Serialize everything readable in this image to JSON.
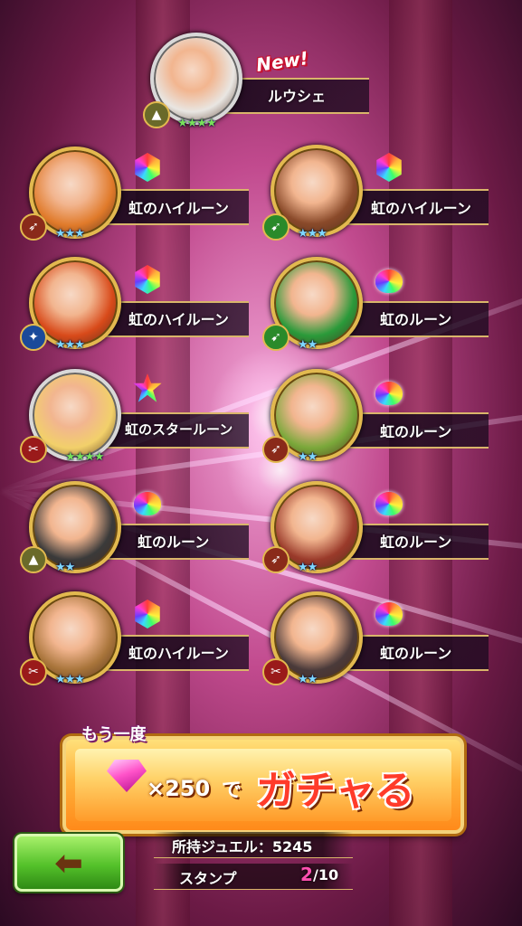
{
  "results": [
    {
      "name": "ルウシェ",
      "is_new": true,
      "new_label": "New!",
      "rarity": 4,
      "attribute": "earth",
      "stars": "★★★★",
      "rune": null
    },
    {
      "label": "虹のハイルーン",
      "rarity": 3,
      "attribute": "bow",
      "stars": "★★★",
      "rune": "rainbow-high-rune"
    },
    {
      "label": "虹のハイルーン",
      "rarity": 3,
      "attribute": "wind",
      "stars": "★★★",
      "rune": "rainbow-high-rune"
    },
    {
      "label": "虹のハイルーン",
      "rarity": 3,
      "attribute": "water",
      "stars": "★★★",
      "rune": "rainbow-high-rune"
    },
    {
      "label": "虹のルーン",
      "rarity": 2,
      "attribute": "wind",
      "stars": "★★",
      "rune": "rainbow-rune"
    },
    {
      "label": "虹のスタールーン",
      "rarity": 4,
      "attribute": "fire",
      "stars": "★★★★",
      "rune": "rainbow-star-rune"
    },
    {
      "label": "虹のルーン",
      "rarity": 2,
      "attribute": "bow",
      "stars": "★★",
      "rune": "rainbow-rune"
    },
    {
      "label": "虹のルーン",
      "rarity": 2,
      "attribute": "earth",
      "stars": "★★",
      "rune": "rainbow-rune"
    },
    {
      "label": "虹のルーン",
      "rarity": 2,
      "attribute": "bow",
      "stars": "★★",
      "rune": "rainbow-rune"
    },
    {
      "label": "虹のハイルーン",
      "rarity": 3,
      "attribute": "fire",
      "stars": "★★★",
      "rune": "rainbow-high-rune"
    },
    {
      "label": "虹のルーン",
      "rarity": 2,
      "attribute": "fire",
      "stars": "★★",
      "rune": "rainbow-rune"
    }
  ],
  "gacha_button": {
    "again_label": "もう一度",
    "cost": "×250",
    "de": "で",
    "action": "ガチャる"
  },
  "footer": {
    "jewels_label": "所持ジュエル：5245",
    "stamp_label": "スタンプ",
    "stamp_current": "2",
    "stamp_total": "/10"
  },
  "colors": {
    "accent_gold": "#e2b94f",
    "gacha_text": "#ff3b2a",
    "back_button": "#54c12a",
    "stamp_current": "#ff4fb0"
  }
}
